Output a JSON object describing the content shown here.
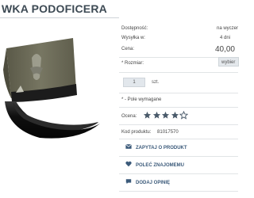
{
  "product": {
    "title": "WKA PODOFICERA"
  },
  "details": {
    "availability_label": "Dostępność:",
    "availability_value": "na wyczer",
    "shipping_label": "Wysyłka w:",
    "shipping_value": "4 dni",
    "price_label": "Cena:",
    "price_value": "40,00",
    "size_label": "* Rozmiar:",
    "size_selected": "wybier"
  },
  "quantity": {
    "value": "1",
    "unit": "szt."
  },
  "required_note": "* - Pole wymagane",
  "rating": {
    "label": "Ocena:",
    "stars_filled": 4,
    "stars_total": 5
  },
  "product_code": {
    "label": "Kod produktu:",
    "value": "81017570"
  },
  "actions": {
    "ask": "ZAPYTAJ O PRODUKT",
    "recommend": "POLEĆ ZNAJOMEMU",
    "review": "DODAJ OPINIĘ"
  },
  "colors": {
    "accent": "#3b5a7a",
    "star": "#4a5a6a",
    "cap_green": "#6b6a55",
    "visor": "#1a1a1a"
  }
}
